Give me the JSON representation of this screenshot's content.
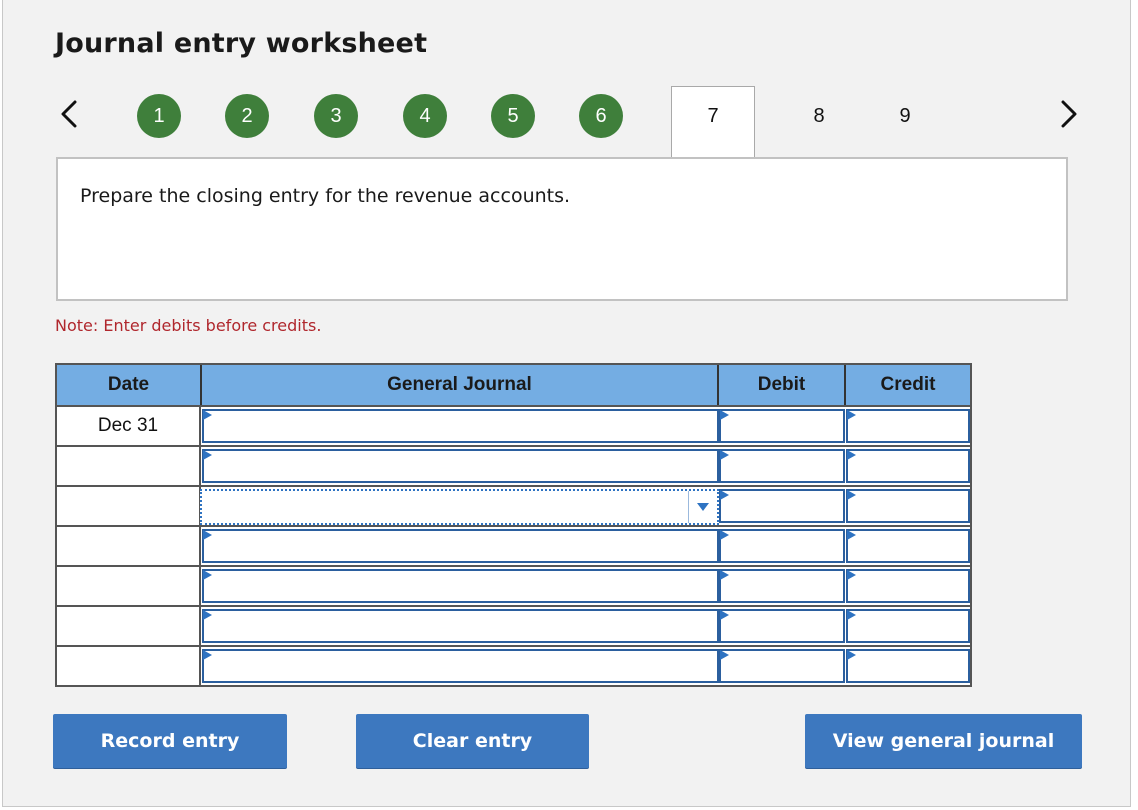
{
  "title": "Journal entry worksheet",
  "steps": [
    "1",
    "2",
    "3",
    "4",
    "5",
    "6",
    "7",
    "8",
    "9"
  ],
  "active_step": "7",
  "prompt": "Prepare the closing entry for the revenue accounts.",
  "note": "Note: Enter debits before credits.",
  "table": {
    "headers": {
      "date": "Date",
      "journal": "General Journal",
      "debit": "Debit",
      "credit": "Credit"
    },
    "rows": [
      {
        "date": "Dec 31",
        "account": "",
        "debit": "",
        "credit": ""
      },
      {
        "date": "",
        "account": "",
        "debit": "",
        "credit": ""
      },
      {
        "date": "",
        "account": "",
        "debit": "",
        "credit": ""
      },
      {
        "date": "",
        "account": "",
        "debit": "",
        "credit": ""
      },
      {
        "date": "",
        "account": "",
        "debit": "",
        "credit": ""
      },
      {
        "date": "",
        "account": "",
        "debit": "",
        "credit": ""
      },
      {
        "date": "",
        "account": "",
        "debit": "",
        "credit": ""
      }
    ]
  },
  "buttons": {
    "record": "Record entry",
    "clear": "Clear entry",
    "view": "View general journal"
  },
  "colors": {
    "completed_step": "#3f7f3b",
    "header_bg": "#74ade3",
    "button_bg": "#3d78bf",
    "note_text": "#b0272d"
  },
  "icons": {
    "prev": "chevron-left-icon",
    "next": "chevron-right-icon",
    "dropdown": "caret-down-icon"
  }
}
